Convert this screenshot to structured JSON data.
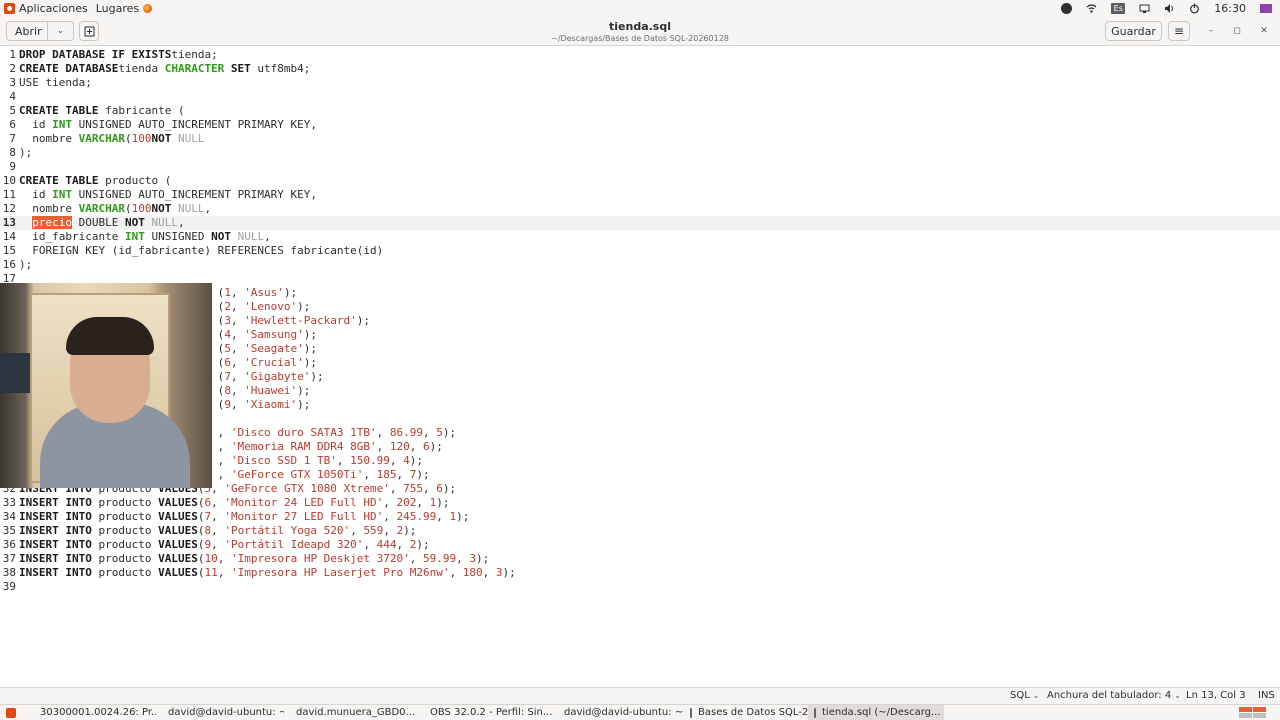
{
  "system_panel": {
    "apps_label": "Aplicaciones",
    "places_label": "Lugares",
    "lang_indicator": "Es",
    "clock": "16:30"
  },
  "header": {
    "open_label": "Abrir",
    "title": "tienda.sql",
    "subtitle": "~/Descargas/Bases de Datos SQL-20260128",
    "save_label": "Guardar",
    "hamburger": "≡",
    "minimize": "–",
    "maximize": "◻",
    "close": "✕"
  },
  "editor": {
    "current_line": 13,
    "lines": [
      {
        "n": "1",
        "tokens": [
          [
            "kw",
            "DROP DATABASE IF EXISTS"
          ],
          [
            "",
            "tienda;"
          ]
        ]
      },
      {
        "n": "2",
        "tokens": [
          [
            "kw",
            "CREATE DATABASE"
          ],
          [
            "",
            "tienda "
          ],
          [
            "ty",
            "CHARACTER"
          ],
          [
            "kw",
            " SET"
          ],
          [
            "",
            " utf8mb4;"
          ]
        ]
      },
      {
        "n": "3",
        "tokens": [
          [
            "",
            "USE tienda;"
          ]
        ]
      },
      {
        "n": "4",
        "tokens": []
      },
      {
        "n": "5",
        "tokens": [
          [
            "kw",
            "CREATE TABLE"
          ],
          [
            "",
            " fabricante ("
          ]
        ]
      },
      {
        "n": "6",
        "tokens": [
          [
            "",
            "  id "
          ],
          [
            "ty",
            "INT"
          ],
          [
            "",
            " UNSIGNED AUTO_INCREMENT PRIMARY KEY,"
          ]
        ]
      },
      {
        "n": "7",
        "tokens": [
          [
            "",
            "  nombre "
          ],
          [
            "ty",
            "VARCHAR"
          ],
          [
            "",
            "("
          ],
          [
            "num",
            "100"
          ],
          [
            ") "
          ],
          [
            "kw",
            "NOT"
          ],
          [
            "",
            " "
          ],
          [
            "null",
            "NULL"
          ]
        ]
      },
      {
        "n": "8",
        "tokens": [
          [
            "",
            ");"
          ]
        ]
      },
      {
        "n": "9",
        "tokens": []
      },
      {
        "n": "10",
        "tokens": [
          [
            "kw",
            "CREATE TABLE"
          ],
          [
            "",
            " producto ("
          ]
        ]
      },
      {
        "n": "11",
        "tokens": [
          [
            "",
            "  id "
          ],
          [
            "ty",
            "INT"
          ],
          [
            "",
            " UNSIGNED AUTO_INCREMENT PRIMARY KEY,"
          ]
        ]
      },
      {
        "n": "12",
        "tokens": [
          [
            "",
            "  nombre "
          ],
          [
            "ty",
            "VARCHAR"
          ],
          [
            "",
            "("
          ],
          [
            "num",
            "100"
          ],
          [
            ") "
          ],
          [
            "kw",
            "NOT"
          ],
          [
            "",
            " "
          ],
          [
            "null",
            "NULL"
          ],
          [
            "",
            ","
          ]
        ]
      },
      {
        "n": "13",
        "tokens": [
          [
            "",
            "  "
          ],
          [
            "sel",
            "precio"
          ],
          [
            "",
            " DOUBLE "
          ],
          [
            "kw",
            "NOT"
          ],
          [
            "",
            " "
          ],
          [
            "null",
            "NULL"
          ],
          [
            "",
            ","
          ]
        ]
      },
      {
        "n": "14",
        "tokens": [
          [
            "",
            "  id_fabricante "
          ],
          [
            "ty",
            "INT"
          ],
          [
            "",
            " UNSIGNED "
          ],
          [
            "kw",
            "NOT"
          ],
          [
            "",
            " "
          ],
          [
            "null",
            "NULL"
          ],
          [
            "",
            ","
          ]
        ]
      },
      {
        "n": "15",
        "tokens": [
          [
            "",
            "  FOREIGN KEY (id_fabricante) REFERENCES fabricante(id)"
          ]
        ]
      },
      {
        "n": "16",
        "tokens": [
          [
            "",
            ");"
          ]
        ]
      },
      {
        "n": "17",
        "tokens": []
      },
      {
        "n": "",
        "tokens": [
          [
            "",
            "                              ("
          ],
          [
            "num",
            "1"
          ],
          [
            "",
            ", "
          ],
          [
            "str",
            "'Asus'"
          ],
          [
            "",
            ");"
          ]
        ]
      },
      {
        "n": "",
        "tokens": [
          [
            "",
            "                              ("
          ],
          [
            "num",
            "2"
          ],
          [
            "",
            ", "
          ],
          [
            "str",
            "'Lenovo'"
          ],
          [
            "",
            ");"
          ]
        ]
      },
      {
        "n": "",
        "tokens": [
          [
            "",
            "                              ("
          ],
          [
            "num",
            "3"
          ],
          [
            "",
            ", "
          ],
          [
            "str",
            "'Hewlett-Packard'"
          ],
          [
            "",
            ");"
          ]
        ]
      },
      {
        "n": "",
        "tokens": [
          [
            "",
            "                              ("
          ],
          [
            "num",
            "4"
          ],
          [
            "",
            ", "
          ],
          [
            "str",
            "'Samsung'"
          ],
          [
            "",
            ");"
          ]
        ]
      },
      {
        "n": "",
        "tokens": [
          [
            "",
            "                              ("
          ],
          [
            "num",
            "5"
          ],
          [
            "",
            ", "
          ],
          [
            "str",
            "'Seagate'"
          ],
          [
            "",
            ");"
          ]
        ]
      },
      {
        "n": "",
        "tokens": [
          [
            "",
            "                              ("
          ],
          [
            "num",
            "6"
          ],
          [
            "",
            ", "
          ],
          [
            "str",
            "'Crucial'"
          ],
          [
            "",
            ");"
          ]
        ]
      },
      {
        "n": "",
        "tokens": [
          [
            "",
            "                              ("
          ],
          [
            "num",
            "7"
          ],
          [
            "",
            ", "
          ],
          [
            "str",
            "'Gigabyte'"
          ],
          [
            "",
            ");"
          ]
        ]
      },
      {
        "n": "",
        "tokens": [
          [
            "",
            "                              ("
          ],
          [
            "num",
            "8"
          ],
          [
            "",
            ", "
          ],
          [
            "str",
            "'Huawei'"
          ],
          [
            "",
            ");"
          ]
        ]
      },
      {
        "n": "",
        "tokens": [
          [
            "",
            "                              ("
          ],
          [
            "num",
            "9"
          ],
          [
            "",
            ", "
          ],
          [
            "str",
            "'Xiaomi'"
          ],
          [
            "",
            ");"
          ]
        ]
      },
      {
        "n": "",
        "tokens": []
      },
      {
        "n": "",
        "tokens": [
          [
            "",
            "                              , "
          ],
          [
            "str",
            "'Disco duro SATA3 1TB'"
          ],
          [
            "",
            ", "
          ],
          [
            "num",
            "86.99"
          ],
          [
            "",
            ", "
          ],
          [
            "num",
            "5"
          ],
          [
            "",
            ");"
          ]
        ]
      },
      {
        "n": "",
        "tokens": [
          [
            "",
            "                              , "
          ],
          [
            "str",
            "'Memoria RAM DDR4 8GB'"
          ],
          [
            "",
            ", "
          ],
          [
            "num",
            "120"
          ],
          [
            "",
            ", "
          ],
          [
            "num",
            "6"
          ],
          [
            "",
            ");"
          ]
        ]
      },
      {
        "n": "",
        "tokens": [
          [
            "",
            "                              , "
          ],
          [
            "str",
            "'Disco SSD 1 TB'"
          ],
          [
            "",
            ", "
          ],
          [
            "num",
            "150.99"
          ],
          [
            "",
            ", "
          ],
          [
            "num",
            "4"
          ],
          [
            "",
            ");"
          ]
        ]
      },
      {
        "n": "",
        "tokens": [
          [
            "",
            "                              , "
          ],
          [
            "str",
            "'GeForce GTX 1050Ti'"
          ],
          [
            "",
            ", "
          ],
          [
            "num",
            "185"
          ],
          [
            "",
            ", "
          ],
          [
            "num",
            "7"
          ],
          [
            "",
            ");"
          ]
        ]
      },
      {
        "n": "32",
        "tokens": [
          [
            "kw",
            "INSERT INTO"
          ],
          [
            "",
            " producto "
          ],
          [
            "kw",
            "VALUES"
          ],
          [
            "",
            "("
          ],
          [
            "num",
            "5"
          ],
          [
            "",
            ", "
          ],
          [
            "str",
            "'GeForce GTX 1080 Xtreme'"
          ],
          [
            "",
            ", "
          ],
          [
            "num",
            "755"
          ],
          [
            "",
            ", "
          ],
          [
            "num",
            "6"
          ],
          [
            "",
            ");"
          ]
        ]
      },
      {
        "n": "33",
        "tokens": [
          [
            "kw",
            "INSERT INTO"
          ],
          [
            "",
            " producto "
          ],
          [
            "kw",
            "VALUES"
          ],
          [
            "",
            "("
          ],
          [
            "num",
            "6"
          ],
          [
            "",
            ", "
          ],
          [
            "str",
            "'Monitor 24 LED Full HD'"
          ],
          [
            "",
            ", "
          ],
          [
            "num",
            "202"
          ],
          [
            "",
            ", "
          ],
          [
            "num",
            "1"
          ],
          [
            "",
            ");"
          ]
        ]
      },
      {
        "n": "34",
        "tokens": [
          [
            "kw",
            "INSERT INTO"
          ],
          [
            "",
            " producto "
          ],
          [
            "kw",
            "VALUES"
          ],
          [
            "",
            "("
          ],
          [
            "num",
            "7"
          ],
          [
            "",
            ", "
          ],
          [
            "str",
            "'Monitor 27 LED Full HD'"
          ],
          [
            "",
            ", "
          ],
          [
            "num",
            "245.99"
          ],
          [
            "",
            ", "
          ],
          [
            "num",
            "1"
          ],
          [
            "",
            ");"
          ]
        ]
      },
      {
        "n": "35",
        "tokens": [
          [
            "kw",
            "INSERT INTO"
          ],
          [
            "",
            " producto "
          ],
          [
            "kw",
            "VALUES"
          ],
          [
            "",
            "("
          ],
          [
            "num",
            "8"
          ],
          [
            "",
            ", "
          ],
          [
            "str",
            "'Portátil Yoga 520'"
          ],
          [
            "",
            ", "
          ],
          [
            "num",
            "559"
          ],
          [
            "",
            ", "
          ],
          [
            "num",
            "2"
          ],
          [
            "",
            ");"
          ]
        ]
      },
      {
        "n": "36",
        "tokens": [
          [
            "kw",
            "INSERT INTO"
          ],
          [
            "",
            " producto "
          ],
          [
            "kw",
            "VALUES"
          ],
          [
            "",
            "("
          ],
          [
            "num",
            "9"
          ],
          [
            "",
            ", "
          ],
          [
            "str",
            "'Portátil Ideapd 320'"
          ],
          [
            "",
            ", "
          ],
          [
            "num",
            "444"
          ],
          [
            "",
            ", "
          ],
          [
            "num",
            "2"
          ],
          [
            "",
            ");"
          ]
        ]
      },
      {
        "n": "37",
        "tokens": [
          [
            "kw",
            "INSERT INTO"
          ],
          [
            "",
            " producto "
          ],
          [
            "kw",
            "VALUES"
          ],
          [
            "",
            "("
          ],
          [
            "num",
            "10"
          ],
          [
            "",
            ", "
          ],
          [
            "str",
            "'Impresora HP Deskjet 3720'"
          ],
          [
            "",
            ", "
          ],
          [
            "num",
            "59.99"
          ],
          [
            "",
            ", "
          ],
          [
            "num",
            "3"
          ],
          [
            "",
            ");"
          ]
        ]
      },
      {
        "n": "38",
        "tokens": [
          [
            "kw",
            "INSERT INTO"
          ],
          [
            "",
            " producto "
          ],
          [
            "kw",
            "VALUES"
          ],
          [
            "",
            "("
          ],
          [
            "num",
            "11"
          ],
          [
            "",
            ", "
          ],
          [
            "str",
            "'Impresora HP Laserjet Pro M26nw'"
          ],
          [
            "",
            ", "
          ],
          [
            "num",
            "180"
          ],
          [
            "",
            ", "
          ],
          [
            "num",
            "3"
          ],
          [
            "",
            ");"
          ]
        ]
      },
      {
        "n": "39",
        "tokens": []
      }
    ]
  },
  "statusbar": {
    "language": "SQL",
    "tab_width": "Anchura del tabulador: 4",
    "position": "Ln 13, Col 3",
    "mode": "INS"
  },
  "taskbar": {
    "items": [
      {
        "label": "30300001.0024.26: Pr...",
        "icon": "firefox-icon"
      },
      {
        "label": "david@david-ubuntu: ~",
        "icon": "terminal-icon"
      },
      {
        "label": "david.munuera_GBD0...",
        "icon": "firefox-icon"
      },
      {
        "label": "OBS 32.0.2 - Perfil: Sin...",
        "icon": "obs-icon"
      },
      {
        "label": "david@david-ubuntu: ~",
        "icon": "terminal-icon"
      },
      {
        "label": "Bases de Datos SQL-2...",
        "icon": "folder-icon"
      },
      {
        "label": "tienda.sql (~/Descarg...",
        "icon": "text-editor-icon",
        "active": true
      }
    ]
  },
  "colors": {
    "accent": "#e66033",
    "type_green": "#2e9b19",
    "literal_red": "#c0392b",
    "null_gray": "#a3a3a3"
  }
}
